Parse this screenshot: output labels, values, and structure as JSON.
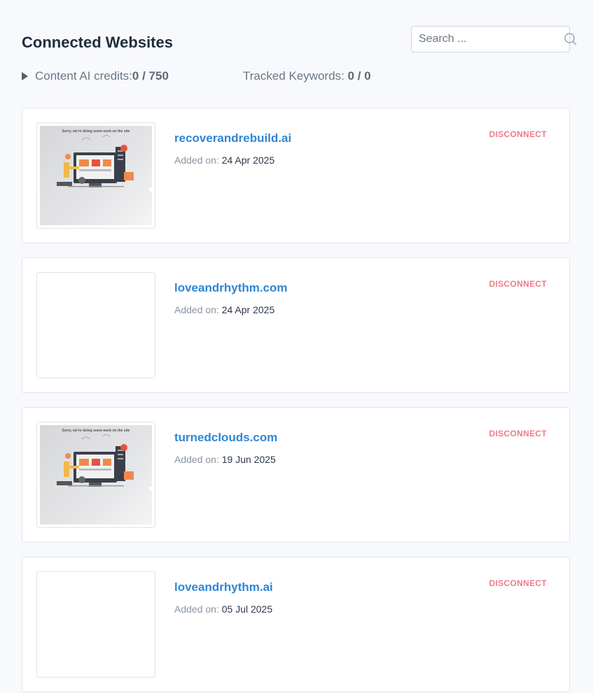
{
  "header": {
    "title": "Connected Websites",
    "search_placeholder": "Search ..."
  },
  "stats": {
    "credits_label": "Content AI credits: ",
    "credits_value": "0 / 750",
    "keywords_label": "Tracked Keywords: ",
    "keywords_value": "0 / 0"
  },
  "sites": [
    {
      "name": "recoverandrebuild.ai",
      "added_label": "Added on: ",
      "added_date": "24 Apr 2025",
      "action": "DISCONNECT",
      "has_preview": true,
      "preview_caption": "Sorry, we're doing some work on the site"
    },
    {
      "name": "loveandrhythm.com",
      "added_label": "Added on: ",
      "added_date": "24 Apr 2025",
      "action": "DISCONNECT",
      "has_preview": false
    },
    {
      "name": "turnedclouds.com",
      "added_label": "Added on: ",
      "added_date": "19 Jun 2025",
      "action": "DISCONNECT",
      "has_preview": true,
      "preview_caption": "Sorry, we're doing some work on the site"
    },
    {
      "name": "loveandrhythm.ai",
      "added_label": "Added on: ",
      "added_date": "05 Jul 2025",
      "action": "DISCONNECT",
      "has_preview": false
    }
  ],
  "colors": {
    "link": "#2f86d4",
    "disconnect": "#ee7c86",
    "page_bg": "#f8f9fc"
  }
}
